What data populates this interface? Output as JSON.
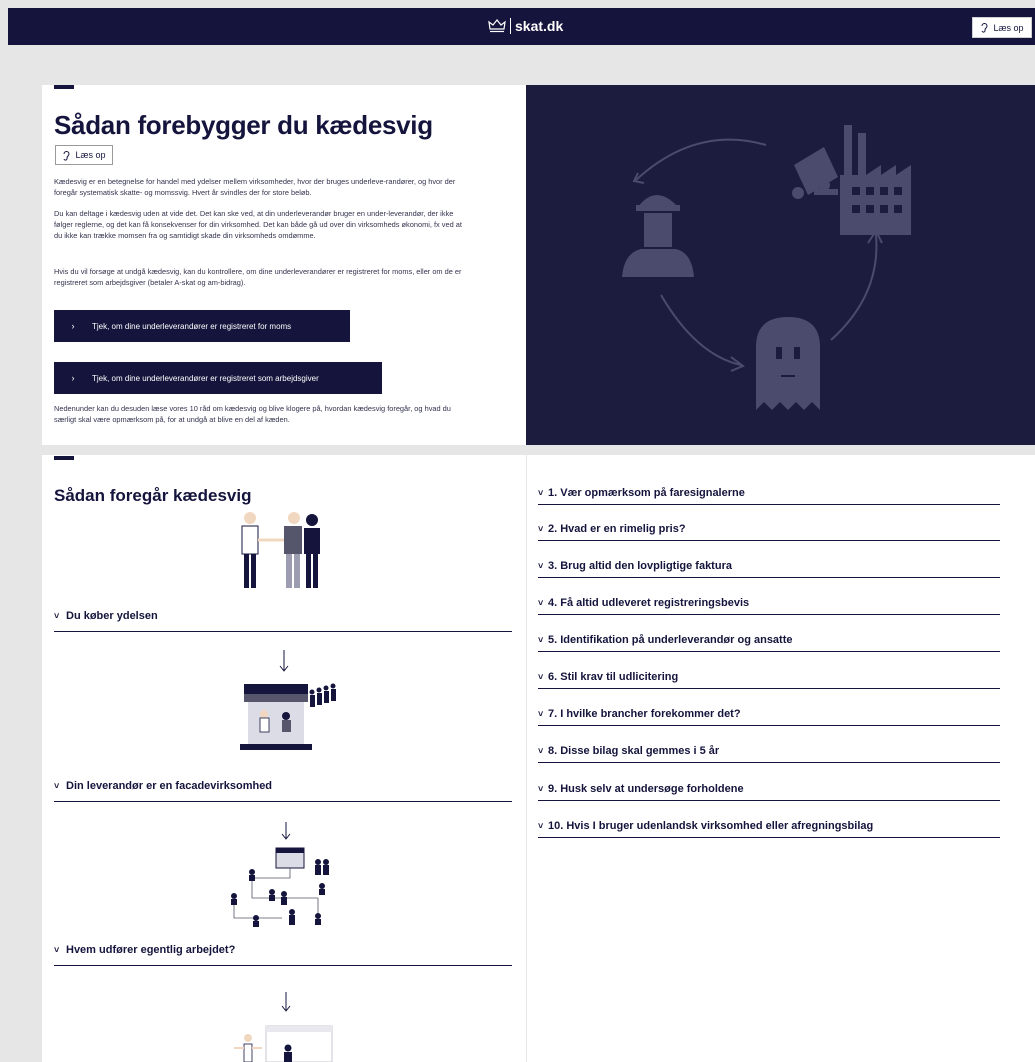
{
  "header": {
    "brand": "skat.dk",
    "listen_label": "Læs op"
  },
  "hero": {
    "title": "Sådan forebygger du kædesvig",
    "listen_label": "Læs op",
    "paragraphs": [
      "Kædesvig er en betegnelse for handel med ydelser mellem virksomheder, hvor der bruges underleve-randører, og hvor der foregår systematisk skatte- og momssvig. Hvert år svindles der for store beløb.",
      "Du kan deltage i kædesvig uden at vide det. Det kan ske ved, at din underleverandør bruger en under-leverandør, der ikke følger reglerne, og det kan få konsekvenser for din virksomhed. Det kan både gå ud over din virksomheds økonomi, fx ved at du ikke kan trække momsen fra og samtidigt skade din virksomheds omdømme.",
      "Hvis du vil forsøge at undgå kædesvig, kan du kontrollere, om dine underleverandører er registreret for moms, eller om de er registreret som arbejdsgiver (betaler A-skat og am-bidrag).",
      "Nedenunder kan du desuden læse vores 10 råd om kædesvig og blive klogere på, hvordan kædesvig foregår, og hvad du særligt skal være opmærksom på, for at undgå at blive en del af kæden."
    ],
    "cta_moms": "Tjek, om dine underleverandører er registreret for moms",
    "cta_employer": "Tjek, om dine underleverandører er registreret som arbejdsgiver"
  },
  "how": {
    "title": "Sådan foregår kædesvig",
    "steps": [
      "Du køber ydelsen",
      "Din leverandør er en facadevirksomhed",
      "Hvem udfører egentlig arbejdet?"
    ]
  },
  "tips": [
    "1. Vær opmærksom på faresignalerne",
    "2. Hvad er en rimelig pris?",
    "3. Brug altid den lovpligtige faktura",
    "4. Få altid udleveret registreringsbevis",
    "5. Identifikation på underleverandør og ansatte",
    "6. Stil krav til udlicitering",
    "7. I hvilke brancher forekommer det?",
    "8. Disse bilag skal gemmes i 5 år",
    "9. Husk selv at undersøge forholdene",
    "10. Hvis I bruger udenlandsk virksomhed eller afregningsbilag"
  ],
  "icons": {
    "chevron": "›",
    "accordion": "˅"
  },
  "colors": {
    "navy": "#14143c",
    "hero_bg": "#1c1c3f",
    "illustration": "#4b4b6e"
  }
}
